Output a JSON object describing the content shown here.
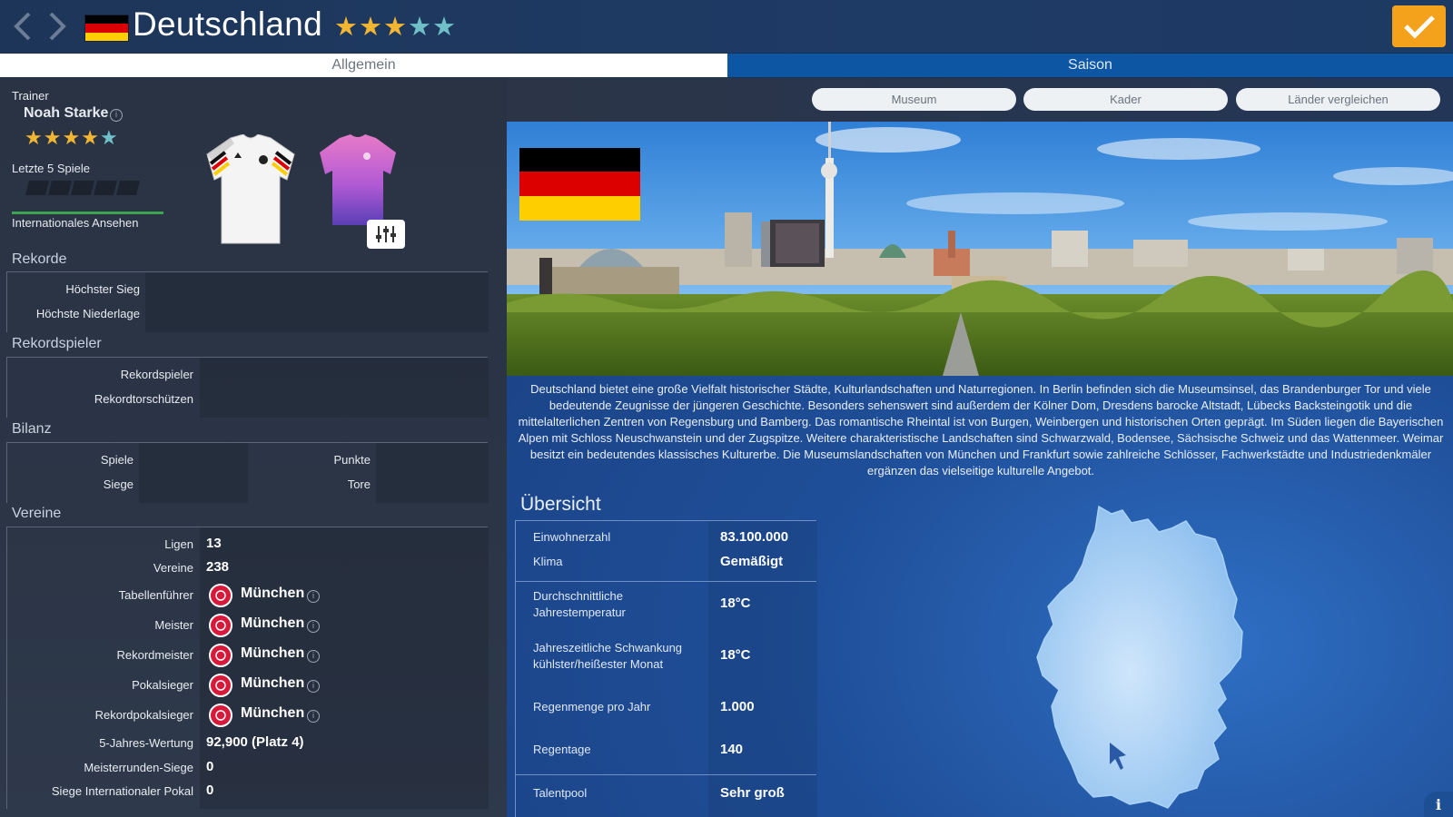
{
  "header": {
    "country_name": "Deutschland",
    "stars_gold": 3,
    "stars_teal": 2,
    "confirm_icon": "check-icon"
  },
  "tabs": {
    "general": "Allgemein",
    "season": "Saison"
  },
  "buttons": {
    "museum": "Museum",
    "squad": "Kader",
    "compare": "Länder vergleichen"
  },
  "trainer": {
    "label": "Trainer",
    "name": "Noah Starke",
    "stars_gold": 4,
    "stars_teal": 1,
    "last5_label": "Letzte 5 Spiele",
    "reputation_label": "Internationales Ansehen"
  },
  "records": {
    "title": "Rekorde",
    "highest_win": "Höchster Sieg",
    "highest_loss": "Höchste Niederlage"
  },
  "record_players": {
    "title": "Rekordspieler",
    "player": "Rekordspieler",
    "scorer": "Rekordtorschützen"
  },
  "balance": {
    "title": "Bilanz",
    "games": "Spiele",
    "wins": "Siege",
    "points": "Punkte",
    "goals": "Tore"
  },
  "clubs": {
    "title": "Vereine",
    "leagues_label": "Ligen",
    "leagues_value": "13",
    "clubs_label": "Vereine",
    "clubs_value": "238",
    "table_leader_label": "Tabellenführer",
    "champion_label": "Meister",
    "record_champion_label": "Rekordmeister",
    "cup_winner_label": "Pokalsieger",
    "record_cup_label": "Rekordpokalsieger",
    "club_name": "München",
    "five_year_label": "5-Jahres-Wertung",
    "five_year_value": "92,900 (Platz 4)",
    "champions_round_label": "Meisterrunden-Siege",
    "champions_round_value": "0",
    "intl_cup_label": "Siege Internationaler Pokal",
    "intl_cup_value": "0"
  },
  "description": "Deutschland bietet eine große Vielfalt historischer Städte, Kulturlandschaften und Naturregionen. In Berlin befinden sich die Museumsinsel, das Brandenburger Tor und viele bedeutende Zeugnisse der jüngeren Geschichte. Besonders sehenswert sind außerdem der Kölner Dom, Dresdens barocke Altstadt, Lübecks Backsteingotik und die mittelalterlichen Zentren von Regensburg und Bamberg. Das romantische Rheintal ist von Burgen, Weinbergen und historischen Orten geprägt. Im Süden liegen die Bayerischen Alpen mit Schloss Neuschwanstein und der Zugspitze. Weitere charakteristische Landschaften sind Schwarzwald, Bodensee, Sächsische Schweiz und das Wattenmeer. Weimar besitzt ein bedeutendes klassisches Kulturerbe. Die Museumslandschaften von München und Frankfurt sowie zahlreiche Schlösser, Fachwerkstädte und Industriedenkmäler ergänzen das vielseitige kulturelle Angebot.",
  "overview": {
    "title": "Übersicht",
    "population_label": "Einwohnerzahl",
    "population_value": "83.100.000",
    "climate_label": "Klima",
    "climate_value": "Gemäßigt",
    "avg_temp_label": "Durchschnittliche Jahrestemperatur",
    "avg_temp_value": "18°C",
    "variation_label": "Jahreszeitliche Schwankung kühlster/heißester Monat",
    "variation_value": "18°C",
    "rain_label": "Regenmenge pro Jahr",
    "rain_value": "1.000",
    "rain_days_label": "Regentage",
    "rain_days_value": "140",
    "talent_label": "Talentpool",
    "talent_value": "Sehr groß"
  },
  "colors": {
    "flag_black": "#000000",
    "flag_red": "#dd0000",
    "flag_gold": "#ffce00",
    "confirm": "#f4a21c",
    "season_tab": "#0d56a3",
    "club": "#d8193a"
  }
}
